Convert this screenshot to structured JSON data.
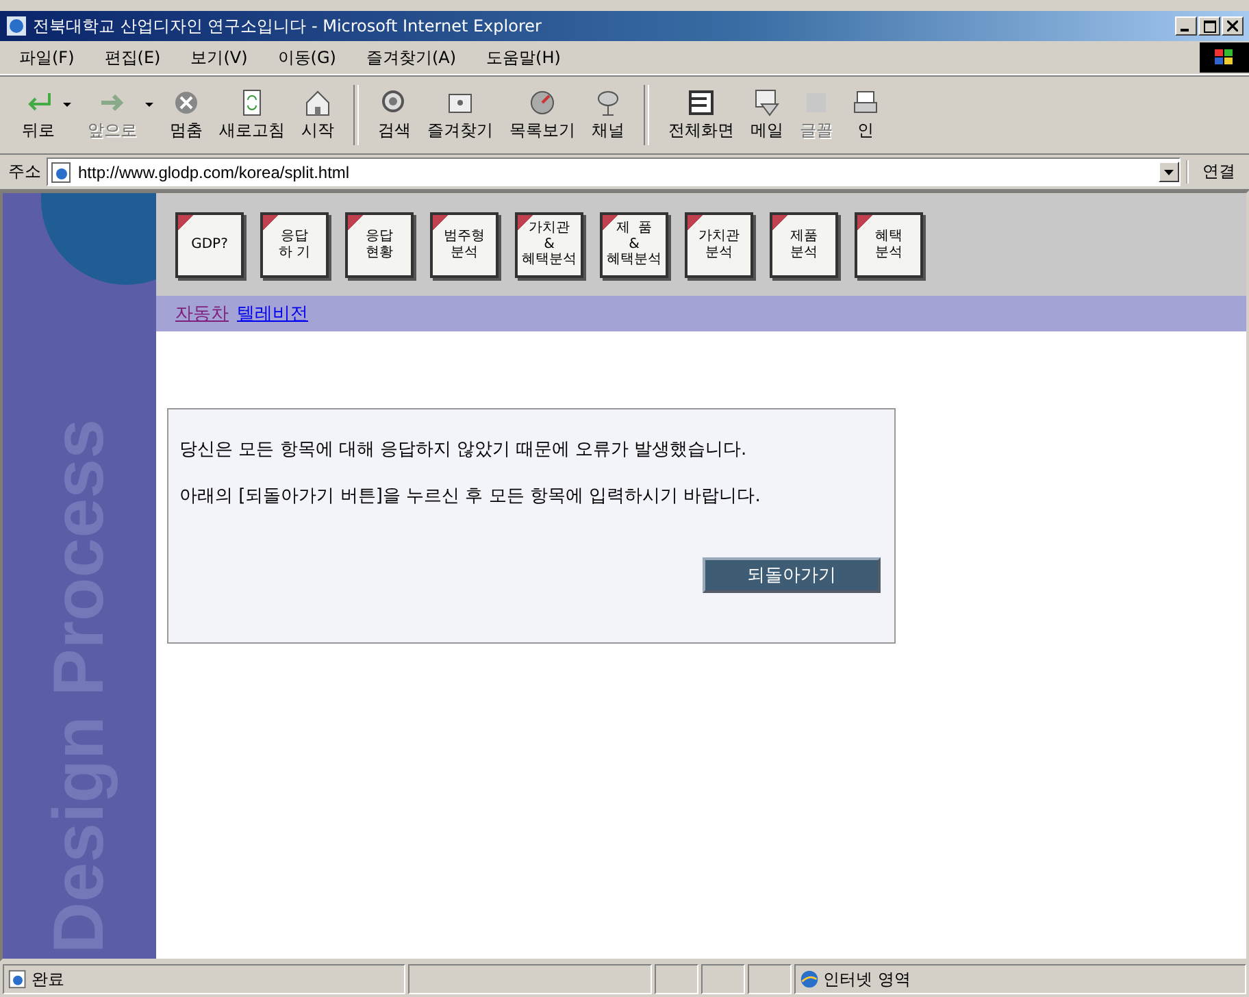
{
  "window": {
    "title": "전북대학교 산업디자인 연구소입니다 - Microsoft Internet Explorer"
  },
  "menu": [
    "파일(F)",
    "편집(E)",
    "보기(V)",
    "이동(G)",
    "즐겨찾기(A)",
    "도움말(H)"
  ],
  "toolbar": [
    {
      "kind": "back",
      "label": "뒤로",
      "disabled": false,
      "dropdown": true
    },
    {
      "kind": "forward",
      "label": "앞으로",
      "disabled": true,
      "dropdown": true
    },
    {
      "kind": "stop",
      "label": "멈춤",
      "disabled": false,
      "dropdown": false
    },
    {
      "kind": "refresh",
      "label": "새로고침",
      "disabled": false,
      "dropdown": false
    },
    {
      "kind": "home",
      "label": "시작",
      "disabled": false,
      "dropdown": false
    },
    {
      "kind": "separator"
    },
    {
      "kind": "search",
      "label": "검색",
      "disabled": false,
      "dropdown": false
    },
    {
      "kind": "favorites",
      "label": "즐겨찾기",
      "disabled": false,
      "dropdown": false
    },
    {
      "kind": "history",
      "label": "목록보기",
      "disabled": false,
      "dropdown": false
    },
    {
      "kind": "channels",
      "label": "채널",
      "disabled": false,
      "dropdown": false
    },
    {
      "kind": "separator"
    },
    {
      "kind": "fullscreen",
      "label": "전체화면",
      "disabled": false,
      "dropdown": false
    },
    {
      "kind": "mail",
      "label": "메일",
      "disabled": false,
      "dropdown": false
    },
    {
      "kind": "font",
      "label": "글꼴",
      "disabled": true,
      "dropdown": false
    },
    {
      "kind": "print",
      "label": "인",
      "disabled": false,
      "dropdown": false
    }
  ],
  "address": {
    "label": "주소",
    "value": "http://www.glodp.com/korea/split.html",
    "links_label": "연결"
  },
  "sidebar": {
    "text": "Design Process"
  },
  "nav_buttons": [
    {
      "lines": [
        "GDP?"
      ]
    },
    {
      "lines": [
        "응답",
        "하 기"
      ]
    },
    {
      "lines": [
        "응답",
        "현황"
      ]
    },
    {
      "lines": [
        "범주형",
        "분석"
      ]
    },
    {
      "lines": [
        "가치관",
        "&",
        "혜택분석"
      ]
    },
    {
      "lines": [
        "제  품",
        "&",
        "혜택분석"
      ]
    },
    {
      "lines": [
        "가치관",
        "분석"
      ]
    },
    {
      "lines": [
        "제품",
        "분석"
      ]
    },
    {
      "lines": [
        "혜택",
        "분석"
      ]
    }
  ],
  "category_links": [
    {
      "label": "자동차",
      "visited": true
    },
    {
      "label": "텔레비전",
      "visited": false
    }
  ],
  "message": {
    "lines": [
      "당신은 모든 항목에 대해 응답하지 않았기 때문에 오류가 발생했습니다.",
      "아래의 [되돌아가기 버튼]을 누르신 후 모든 항목에 입력하시기 바랍니다."
    ],
    "button": "되돌아가기"
  },
  "status_bar": {
    "text": "완료",
    "zone": "인터넷 영역"
  }
}
